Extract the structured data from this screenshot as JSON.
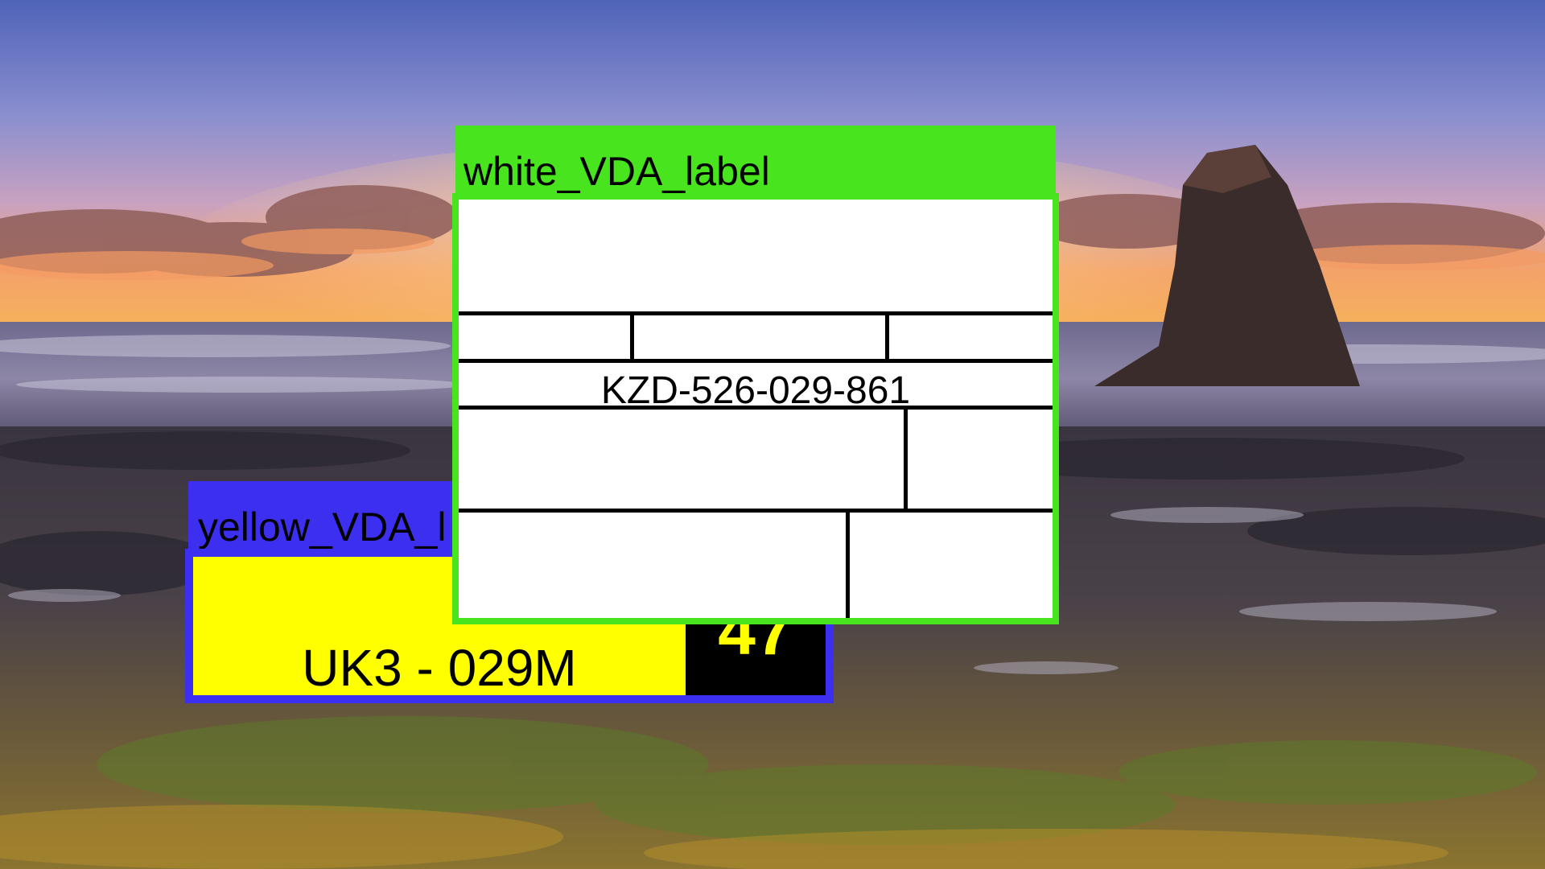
{
  "yellow_label": {
    "title": "yellow_VDA_l",
    "code": "UK3 - 029M",
    "number": "47"
  },
  "white_label": {
    "title": "white_VDA_label",
    "code": "KZD-526-029-861"
  },
  "colors": {
    "yellow_frame": "#3c2ff0",
    "white_frame": "#48e51e",
    "yellow_fill": "#ffff00",
    "number_background": "#000000"
  }
}
